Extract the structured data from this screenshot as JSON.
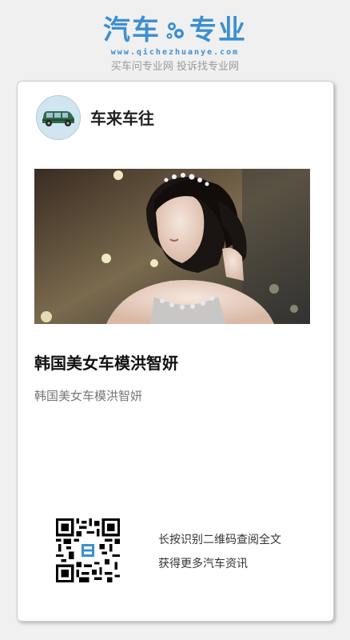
{
  "header": {
    "logo_left": "汽车",
    "logo_right": "专业",
    "logo_url": "www.qichezhuanye.com",
    "slogan": "买车问专业网 投诉找专业网"
  },
  "card": {
    "author": "车来车往",
    "title": "韩国美女车模洪智妍",
    "summary": "韩国美女车模洪智妍",
    "qr_line1": "长按识别二维码查阅全文",
    "qr_line2": "获得更多汽车资讯"
  },
  "icons": {
    "gear": "gear-icon",
    "avatar": "car-icon",
    "qr": "qr-code-icon"
  },
  "colors": {
    "brand": "#3d8fd1",
    "slogan": "#999999"
  }
}
